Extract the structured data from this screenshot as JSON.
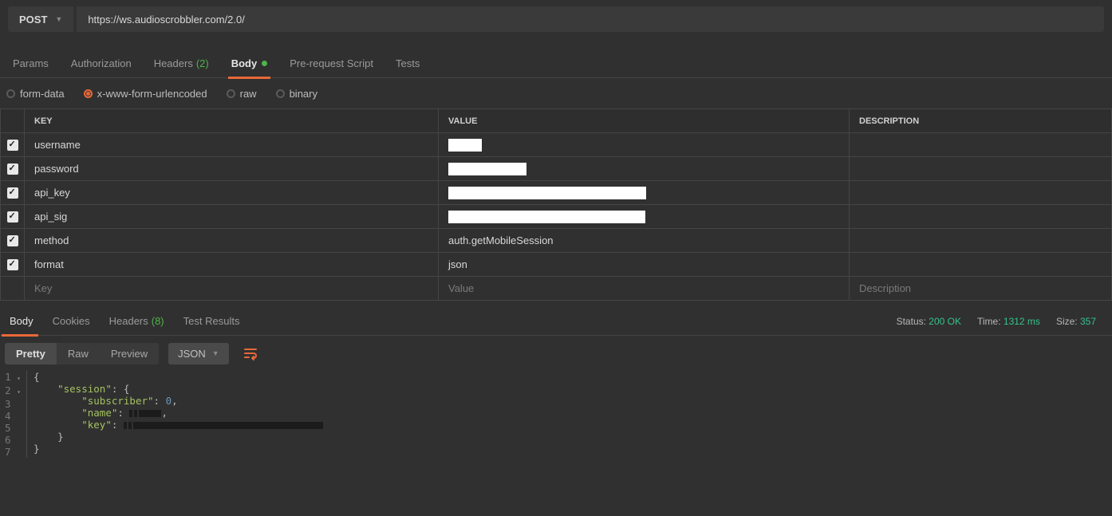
{
  "request": {
    "method": "POST",
    "url": "https://ws.audioscrobbler.com/2.0/"
  },
  "reqTabs": {
    "params": "Params",
    "authorization": "Authorization",
    "headers": "Headers",
    "headers_count": "(2)",
    "body": "Body",
    "prerequest": "Pre-request Script",
    "tests": "Tests"
  },
  "bodyTypes": {
    "form": "form-data",
    "urlenc": "x-www-form-urlencoded",
    "raw": "raw",
    "binary": "binary"
  },
  "kv": {
    "h_key": "KEY",
    "h_value": "VALUE",
    "h_desc": "DESCRIPTION",
    "rows": [
      {
        "key": "username",
        "val": "",
        "redact": "r1"
      },
      {
        "key": "password",
        "val": "",
        "redact": "r2"
      },
      {
        "key": "api_key",
        "val": "",
        "redact": "r3"
      },
      {
        "key": "api_sig",
        "val": "",
        "redact": "r4"
      },
      {
        "key": "method",
        "val": "auth.getMobileSession"
      },
      {
        "key": "format",
        "val": "json"
      }
    ],
    "ph_key": "Key",
    "ph_val": "Value",
    "ph_desc": "Description"
  },
  "respTabs": {
    "body": "Body",
    "cookies": "Cookies",
    "headers": "Headers",
    "headers_count": "(8)",
    "testresults": "Test Results"
  },
  "respMeta": {
    "status_lbl": "Status:",
    "status": "200 OK",
    "time_lbl": "Time:",
    "time": "1312 ms",
    "size_lbl": "Size:",
    "size": "357"
  },
  "respToolbar": {
    "pretty": "Pretty",
    "raw": "Raw",
    "preview": "Preview",
    "format": "JSON"
  },
  "json": {
    "k_session": "\"session\"",
    "k_subscriber": "\"subscriber\"",
    "v_subscriber": "0",
    "k_name": "\"name\"",
    "k_key": "\"key\""
  }
}
